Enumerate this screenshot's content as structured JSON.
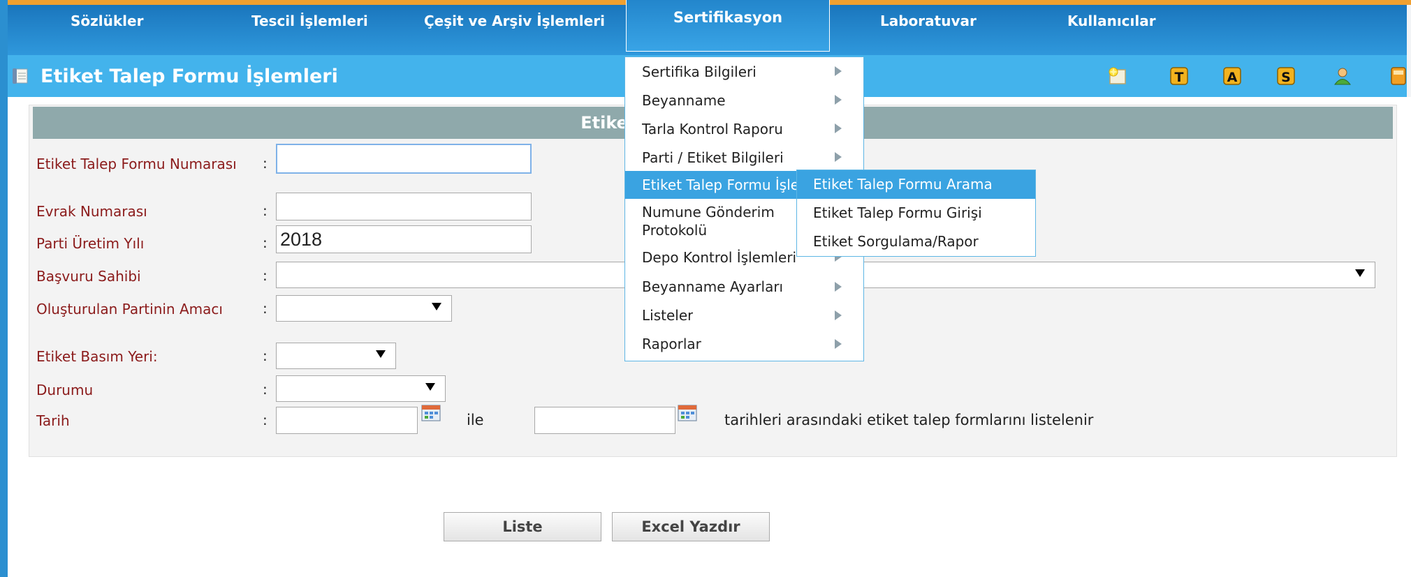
{
  "nav": {
    "items": [
      "Sözlükler",
      "Tescil İşlemleri",
      "Çeşit ve Arşiv İşlemleri",
      "Sertifikasyon",
      "Laboratuvar",
      "Kullanıcılar"
    ]
  },
  "page": {
    "title": "Etiket Talep Formu İşlemleri",
    "panel_header": "Etiket Talep Formu İşlemleri"
  },
  "form": {
    "talep_no_label": "Etiket Talep Formu Numarası",
    "talep_no_value": "",
    "evrak_label": "Evrak Numarası",
    "evrak_value": "",
    "yil_label": "Parti Üretim Yılı",
    "yil_value": "2018",
    "basvuru_label": "Başvuru Sahibi",
    "basvuru_value": "",
    "amac_label": "Oluşturulan Partinin Amacı",
    "amac_value": "",
    "basim_label": "Etiket Basım Yeri:",
    "basim_value": "",
    "durum_label": "Durumu",
    "durum_value": "",
    "tarih_label": "Tarih",
    "tarih_baslangic": "",
    "tarih_bitis": "",
    "ile_text": "ile",
    "tarih_aciklama": "tarihleri arasındaki etiket talep formlarını listelenir",
    "colon": ":"
  },
  "buttons": {
    "liste": "Liste",
    "excel": "Excel Yazdır"
  },
  "dropdown_menu": {
    "items": [
      "Sertifika Bilgileri",
      "Beyanname",
      "Tarla Kontrol Raporu",
      "Parti / Etiket Bilgileri",
      "Etiket Talep Formu İşlemleri",
      "Numune Gönderim Protokolü",
      "Depo Kontrol İşlemleri",
      "Beyanname Ayarları",
      "Listeler",
      "Raporlar"
    ],
    "highlighted_index": 4
  },
  "submenu": {
    "items": [
      "Etiket Talep Formu Arama",
      "Etiket Talep Formu Girişi",
      "Etiket Sorgulama/Rapor"
    ],
    "highlighted_index": 0
  },
  "toolbar_icons": [
    "new-icon",
    "t-letter-icon",
    "a-letter-icon",
    "s-letter-icon",
    "user-icon",
    "exit-icon"
  ],
  "colors": {
    "nav_bar": "#1a76bd",
    "title_bar": "#43b3ec",
    "panel_header": "#8fa9ab",
    "label_text": "#8b1b1b",
    "menu_highlight": "#3aa3e1",
    "top_strip": "#f0a030"
  }
}
